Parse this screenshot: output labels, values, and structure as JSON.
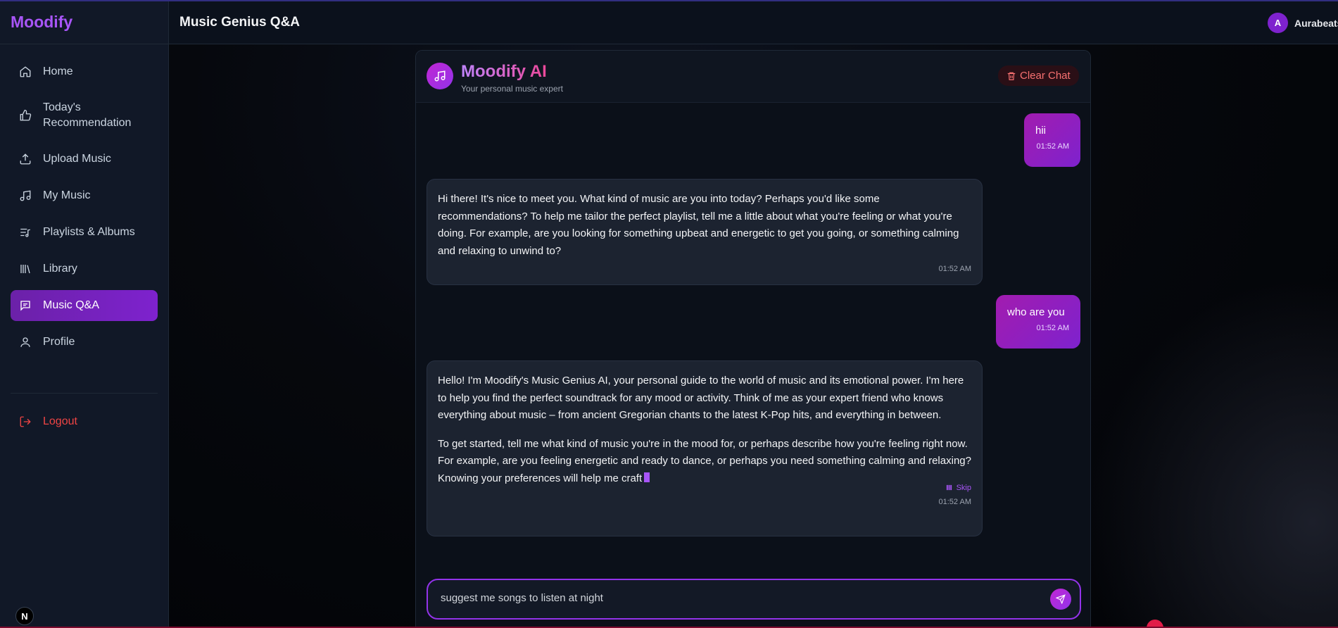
{
  "app": {
    "name": "Moodify"
  },
  "header": {
    "title": "Music Genius Q&A",
    "user_initial": "A",
    "username": "Aurabeats"
  },
  "sidebar": {
    "items": [
      {
        "label": "Home",
        "icon": "home-icon"
      },
      {
        "label": "Today's Recommendation",
        "icon": "thumbs-up-icon"
      },
      {
        "label": "Upload Music",
        "icon": "upload-icon"
      },
      {
        "label": "My Music",
        "icon": "music-note-icon"
      },
      {
        "label": "Playlists & Albums",
        "icon": "playlist-icon"
      },
      {
        "label": "Library",
        "icon": "library-icon"
      },
      {
        "label": "Music Q&A",
        "icon": "chat-icon",
        "active": true
      },
      {
        "label": "Profile",
        "icon": "user-icon"
      }
    ],
    "logout": "Logout",
    "badge": "N"
  },
  "chat": {
    "ai_name": "Moodify AI",
    "ai_subtitle": "Your personal music expert",
    "clear_label": "Clear Chat",
    "messages": [
      {
        "role": "user",
        "text": "hii",
        "time": "01:52 AM"
      },
      {
        "role": "ai",
        "text": "Hi there!  It's nice to meet you.  What kind of music are you into today?  Perhaps you'd like some recommendations?  To help me tailor the perfect playlist, tell me a little about what you're feeling or what you're doing.  For example, are you looking for something upbeat and energetic to get you going, or something calming and relaxing to unwind to?",
        "time": "01:52 AM"
      },
      {
        "role": "user",
        "text": "who are you",
        "time": "01:52 AM"
      },
      {
        "role": "ai",
        "text": "Hello! I'm Moodify's Music Genius AI, your personal guide to the world of music and its emotional power.  I'm here to help you find the perfect soundtrack for any mood or activity.  Think of me as your expert friend who knows everything about music – from ancient Gregorian chants to the latest K-Pop hits, and everything in between.",
        "text2": "To get started, tell me what kind of music you're in the mood for, or perhaps describe how you're feeling right now.  For example, are you feeling energetic and ready to dance, or perhaps you need something calming and relaxing?  Knowing your preferences will help me craft",
        "skip_label": "Skip",
        "time": "01:52 AM"
      }
    ],
    "input_value": "suggest me songs to listen at night"
  },
  "colors": {
    "accent": "#9333ea",
    "brand": "#a855f7",
    "danger": "#ef4444"
  }
}
